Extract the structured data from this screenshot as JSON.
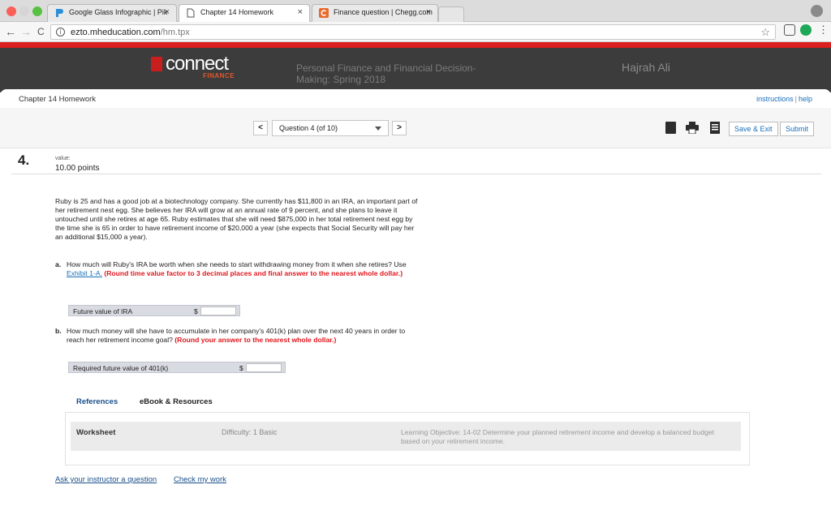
{
  "browser": {
    "tabs": [
      {
        "label": "Google Glass Infographic | Pik",
        "close": "×"
      },
      {
        "label": "Chapter 14 Homework",
        "close": "×"
      },
      {
        "label": "Finance question | Chegg.com",
        "close": "×"
      }
    ],
    "url_host": "ezto.mheducation.com",
    "url_path": "/hm.tpx",
    "back": "←",
    "forward": "→",
    "reload": "C",
    "star": "☆",
    "menu": "⋮"
  },
  "header": {
    "logo_text": "connect",
    "logo_sub": "FINANCE",
    "course_title": "Personal Finance and Financial Decision-Making: Spring 2018",
    "user_name": "Hajrah Ali"
  },
  "page": {
    "homework_title": "Chapter 14 Homework",
    "instructions_link": "instructions",
    "help_sep": "|",
    "help_link": "help"
  },
  "question_nav": {
    "prev": "<",
    "next": ">",
    "selected": "Question 4 (of 10)",
    "save_exit": "Save & Exit",
    "submit": "Submit"
  },
  "question": {
    "number": "4.",
    "value_label": "value:",
    "points": "10.00 points",
    "problem": "Ruby is 25 and has a good job at a biotechnology company. She currently has $11,800 in an IRA, an important part of her retirement nest egg. She believes her IRA will grow at an annual rate of 9 percent, and she plans to leave it untouched until she retires at age 65. Ruby estimates that she will need $875,000 in her total retirement nest egg by the time she is 65 in order to have retirement income of $20,000 a year (she expects that Social Security will pay her an additional $15,000 a year).",
    "part_a": {
      "letter": "a.",
      "text_pre": "How much will Ruby's IRA be worth when she needs to start withdrawing money from it when she retires? Use",
      "link": "Exhibit 1-A.",
      "instruction": "(Round time value factor to 3 decimal places and final answer to the nearest whole dollar.)",
      "answer_label": "Future value of IRA",
      "currency": "$",
      "answer_value": ""
    },
    "part_b": {
      "letter": "b.",
      "text_pre": "How much money will she have to accumulate in her company's 401(k) plan over the next 40 years in order to reach her retirement income goal?",
      "instruction": "(Round your answer to the nearest whole dollar.)",
      "answer_label": "Required future value of 401(k)",
      "currency": "$",
      "answer_value": ""
    }
  },
  "references": {
    "tab_references": "References",
    "tab_ebook": "eBook & Resources",
    "worksheet": "Worksheet",
    "difficulty": "Difficulty: 1 Basic",
    "learning_objective": "Learning Objective: 14-02 Determine your planned retirement income and develop a balanced budget based on your retirement income."
  },
  "footer_links": {
    "ask": "Ask your instructor a question",
    "check": "Check my work"
  },
  "colors": {
    "accent_red": "#d91f1f",
    "header_dark": "#3c3c3c",
    "link_blue": "#1a6fb8",
    "instruction_red": "#e0161d"
  }
}
